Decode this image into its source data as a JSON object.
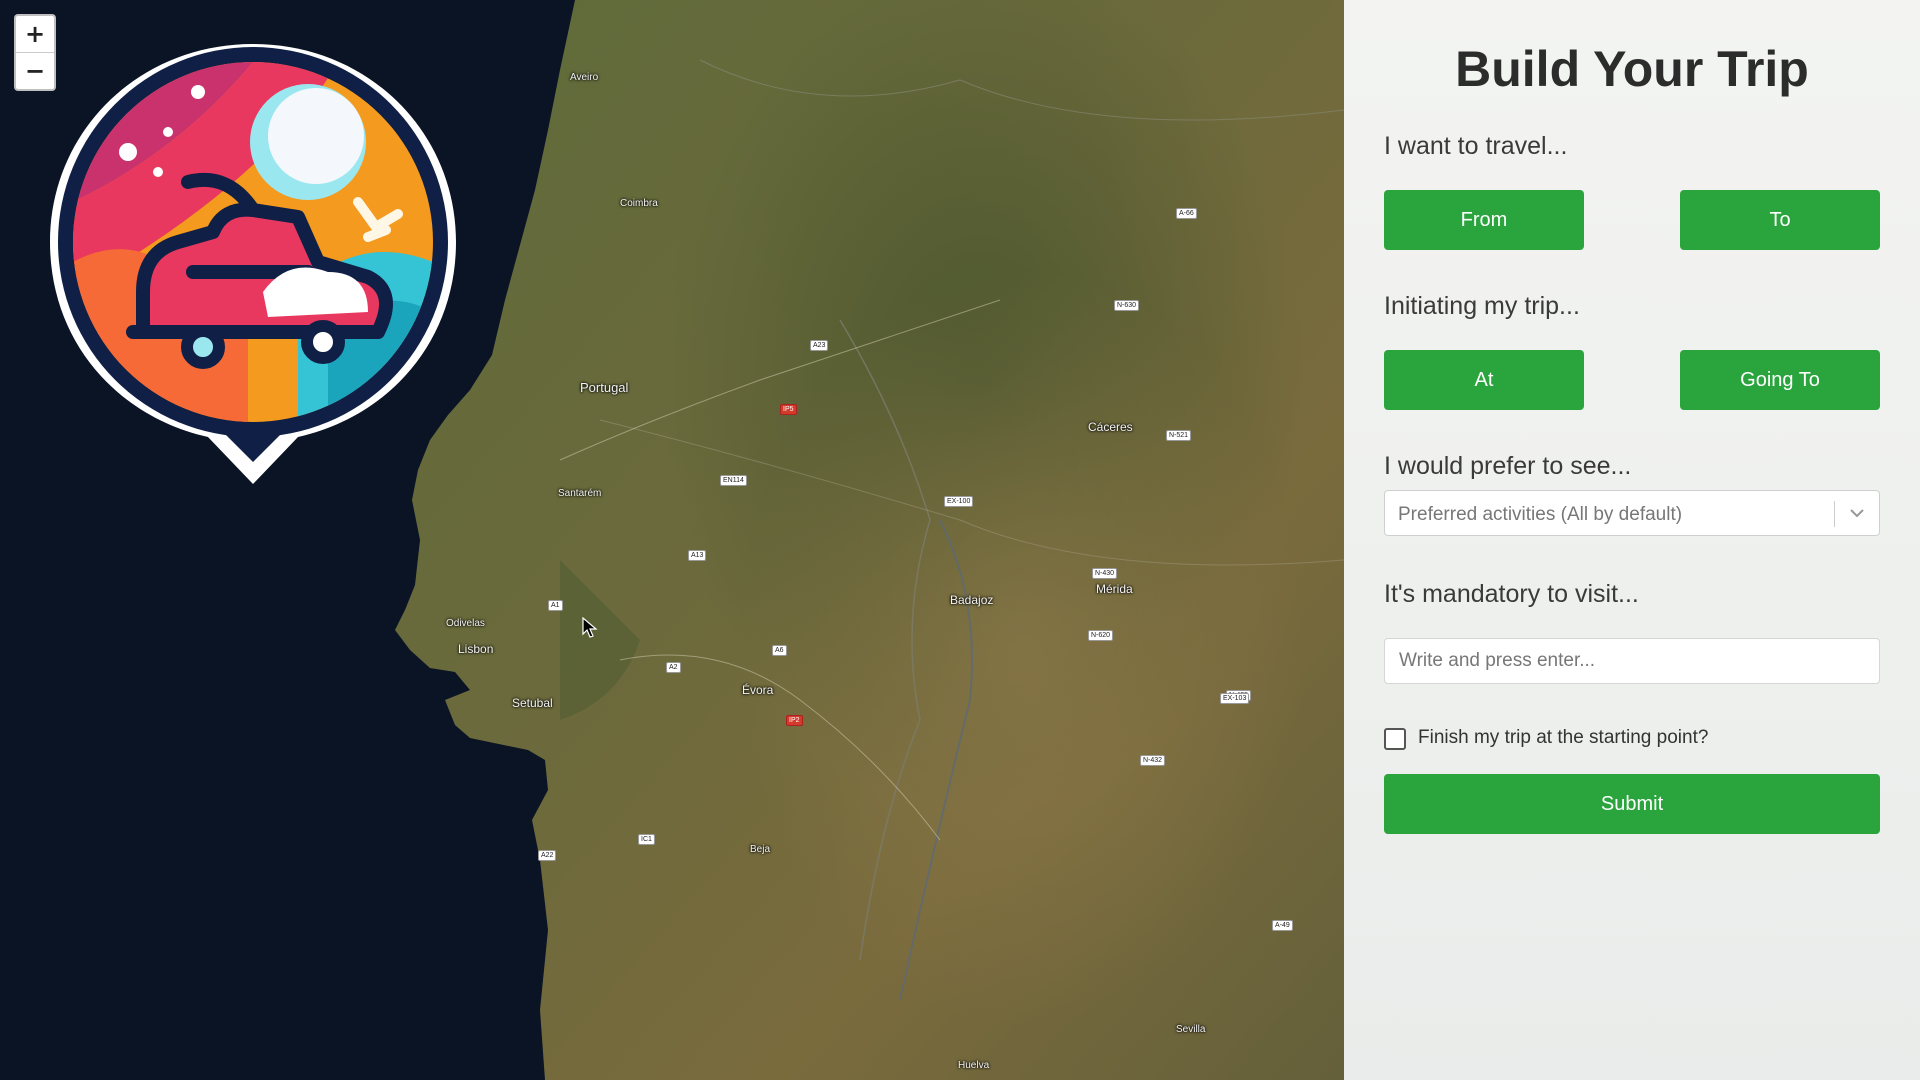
{
  "map": {
    "zoom_in": "+",
    "zoom_out": "−",
    "places": [
      {
        "name": "Portugal"
      },
      {
        "name": "Lisbon"
      },
      {
        "name": "Setubal"
      },
      {
        "name": "Odivelas"
      },
      {
        "name": "Évora"
      },
      {
        "name": "Badajoz"
      },
      {
        "name": "Mérida"
      },
      {
        "name": "Cáceres"
      },
      {
        "name": "Coimbra"
      },
      {
        "name": "Aveiro"
      },
      {
        "name": "Santarém"
      },
      {
        "name": "Sevilla"
      },
      {
        "name": "Huelva"
      },
      {
        "name": "Beja"
      }
    ],
    "roads": [
      "A1",
      "A2",
      "A6",
      "A23",
      "A13",
      "IP2",
      "IC1",
      "A22",
      "EN114",
      "N-630",
      "A-66",
      "N-521",
      "N-432",
      "A-49",
      "N-435",
      "EX-103",
      "N-430",
      "EX-100",
      "IP5",
      "N-620"
    ],
    "colors": {
      "sea": "#0a1424",
      "land": "#6b6a3a"
    }
  },
  "logo": {
    "icon": "travel-car-pin-icon",
    "colors": {
      "ring": "#0f1f45",
      "border": "#ffffff",
      "sun": "#f39a1f",
      "pink": "#e8385f",
      "teal": "#34c4d6"
    }
  },
  "panel": {
    "title": "Build Your Trip",
    "travel_label": "I want to travel...",
    "from_button": "From",
    "to_button": "To",
    "initiating_label": "Initiating my trip...",
    "at_button": "At",
    "going_to_button": "Going To",
    "prefer_label": "I would prefer to see...",
    "activities_select": {
      "placeholder": "Preferred activities (All by default)"
    },
    "mandatory_label": "It's mandatory to visit...",
    "mandatory_input": {
      "placeholder": "Write and press enter...",
      "value": ""
    },
    "finish_checkbox": {
      "label": "Finish my trip at the starting point?",
      "checked": false
    },
    "submit_button": "Submit",
    "colors": {
      "accent": "#2aa43c",
      "text": "#3a3a3a"
    }
  }
}
